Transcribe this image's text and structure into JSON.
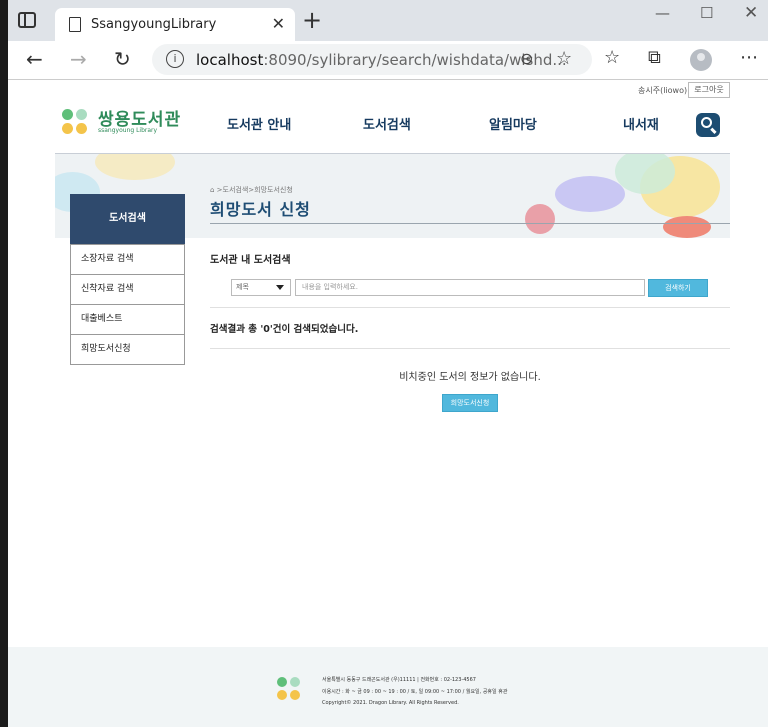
{
  "browser": {
    "tab_title": "SsangyoungLibrary",
    "url_host": "localhost",
    "url_rest": ":8090/sylibrary/search/wishdata/wishd..."
  },
  "header": {
    "user_label": "송시주(liowo)",
    "logout_label": "로그아웃",
    "logo_name": "쌍용도서관",
    "logo_sub": "ssangyoung Library",
    "menu": [
      "도서관 안내",
      "도서검색",
      "알림마당",
      "내서재"
    ]
  },
  "banner": {
    "breadcrumb": ">도서검색>희망도서신청",
    "heading": "희망도서 신청"
  },
  "sidebar": {
    "title": "도서검색",
    "items": [
      "소장자료 검색",
      "신착자료 검색",
      "대출베스트",
      "희망도서신청"
    ]
  },
  "main": {
    "section_title": "도서관 내 도서검색",
    "select_value": "제목",
    "input_placeholder": "내용을 입력하세요.",
    "search_button": "검색하기",
    "result_text": "검색결과 총 '0'건이 검색되었습니다.",
    "empty_message": "비치중인 도서의 정보가 없습니다.",
    "wish_button": "희망도서신청"
  },
  "footer": {
    "lines": [
      "서울특별시 동동구 드래곤도서관 (우)11111 | 전화번호 : 02-123-4567",
      "이용시간 : 화 ~ 금 09 : 00 ~ 19 : 00 / 토, 일 09:00 ~ 17:00 / 월요일, 공휴일 휴관",
      "Copyright© 2021. Dragon Library. All Rights Reserved."
    ]
  },
  "colors": {
    "brand_green": "#2f8b5a",
    "nav_blue": "#163a5f",
    "sidebar_head": "#2f4a6d",
    "button_blue": "#51b8dd"
  }
}
